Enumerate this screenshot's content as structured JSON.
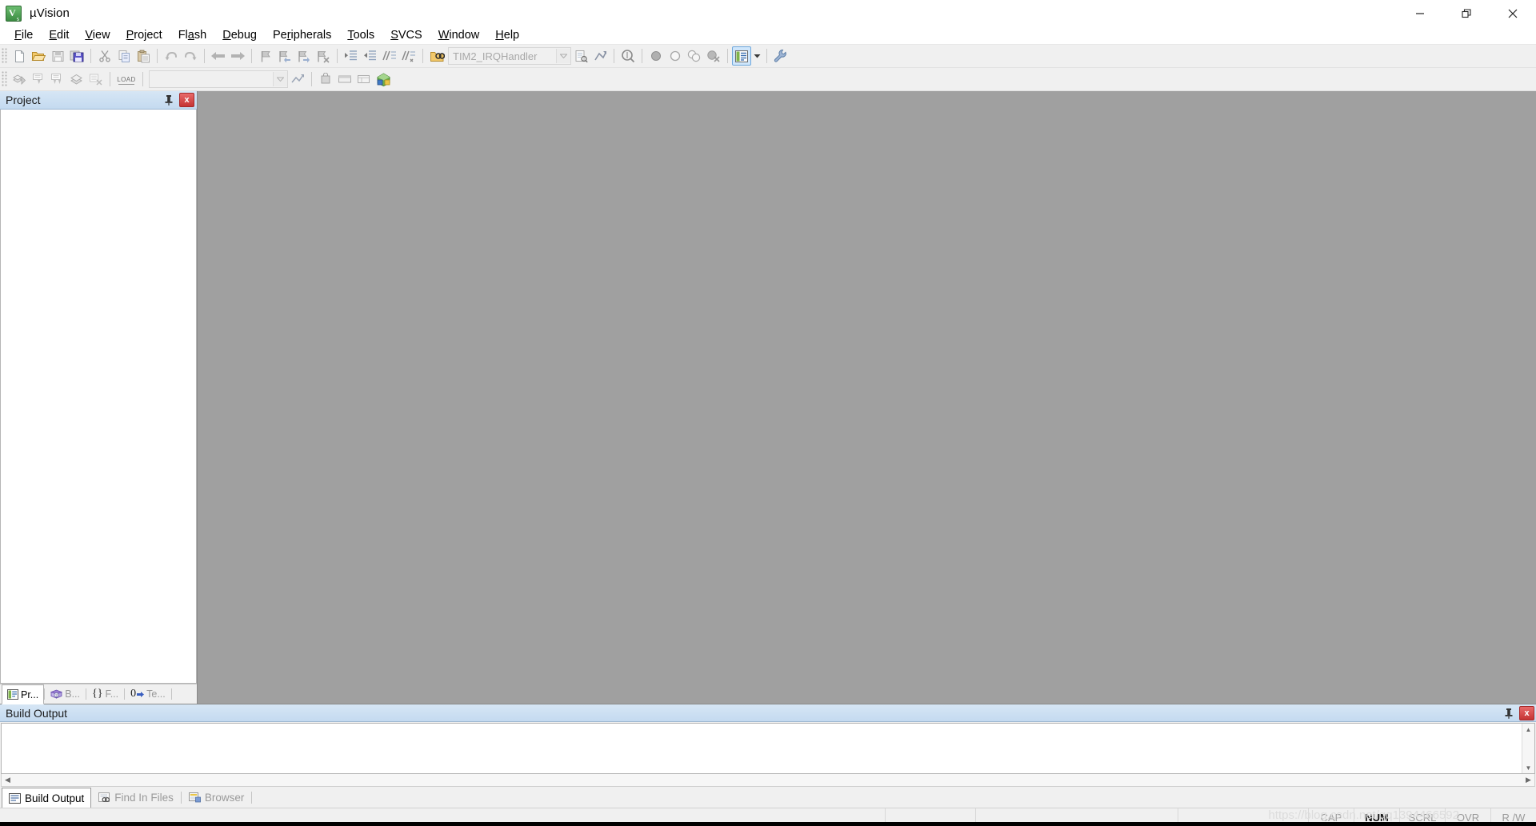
{
  "window": {
    "title": "µVision",
    "app_icon": "uvision-app-icon",
    "controls": {
      "minimize": "Minimize",
      "restore": "Restore",
      "close": "Close"
    }
  },
  "menubar": {
    "items": [
      {
        "label": "File",
        "accel": "F"
      },
      {
        "label": "Edit",
        "accel": "E"
      },
      {
        "label": "View",
        "accel": "V"
      },
      {
        "label": "Project",
        "accel": "P"
      },
      {
        "label": "Flash",
        "accel": "a"
      },
      {
        "label": "Debug",
        "accel": "D"
      },
      {
        "label": "Peripherals",
        "accel": "r"
      },
      {
        "label": "Tools",
        "accel": "T"
      },
      {
        "label": "SVCS",
        "accel": "S"
      },
      {
        "label": "Window",
        "accel": "W"
      },
      {
        "label": "Help",
        "accel": "H"
      }
    ]
  },
  "toolbar_file": {
    "buttons": [
      {
        "name": "new-file-icon",
        "label": "New"
      },
      {
        "name": "open-file-icon",
        "label": "Open"
      },
      {
        "name": "save-icon",
        "label": "Save"
      },
      {
        "name": "save-all-icon",
        "label": "Save All"
      },
      {
        "name": "cut-icon",
        "label": "Cut"
      },
      {
        "name": "copy-icon",
        "label": "Copy"
      },
      {
        "name": "paste-icon",
        "label": "Paste"
      },
      {
        "name": "undo-icon",
        "label": "Undo"
      },
      {
        "name": "redo-icon",
        "label": "Redo"
      },
      {
        "name": "navigate-back-icon",
        "label": "Back"
      },
      {
        "name": "navigate-forward-icon",
        "label": "Forward"
      },
      {
        "name": "bookmark-toggle-icon",
        "label": "Insert/Remove Bookmark"
      },
      {
        "name": "bookmark-prev-icon",
        "label": "Go to Previous Bookmark"
      },
      {
        "name": "bookmark-next-icon",
        "label": "Go to Next Bookmark"
      },
      {
        "name": "bookmark-clear-icon",
        "label": "Clear All Bookmarks"
      },
      {
        "name": "indent-right-icon",
        "label": "Indent Selection"
      },
      {
        "name": "indent-left-icon",
        "label": "Unindent Selection"
      },
      {
        "name": "comment-icon",
        "label": "Comment Selection"
      },
      {
        "name": "uncomment-icon",
        "label": "Uncomment Selection"
      }
    ],
    "function_combo": {
      "name": "function-navigation-combo",
      "value": "TIM2_IRQHandler"
    },
    "after_combo": [
      {
        "name": "find-in-files-icon",
        "label": "Find in Files"
      },
      {
        "name": "incremental-find-icon",
        "label": "Incremental Find"
      },
      {
        "name": "magnifier-icon",
        "label": "Find"
      },
      {
        "name": "breakpoint-insert-icon",
        "label": "Insert/Remove Breakpoint"
      },
      {
        "name": "breakpoint-disable-icon",
        "label": "Enable/Disable Breakpoint"
      },
      {
        "name": "breakpoint-disable-all-icon",
        "label": "Disable All Breakpoints"
      },
      {
        "name": "breakpoint-kill-all-icon",
        "label": "Kill All Breakpoints"
      }
    ],
    "target_options": {
      "name": "configure-target-options-button",
      "label": "Configure Target Options",
      "active": true,
      "highlight_color": "#cfe6fb"
    },
    "wrench": {
      "name": "manage-run-time-environment-icon",
      "label": "Manage Run-Time Environment"
    }
  },
  "toolbar_build": {
    "buttons": [
      {
        "name": "translate-file-icon",
        "label": "Translate Current File"
      },
      {
        "name": "build-target-icon",
        "label": "Build"
      },
      {
        "name": "rebuild-all-icon",
        "label": "Rebuild All Target Files"
      },
      {
        "name": "batch-build-icon",
        "label": "Batch Build"
      },
      {
        "name": "stop-build-icon",
        "label": "Stop Build"
      }
    ],
    "load_button": {
      "name": "download-to-flash-button",
      "label": "LOAD"
    },
    "target_combo": {
      "name": "select-target-combo",
      "value": ""
    },
    "after_combo": [
      {
        "name": "target-options-icon",
        "label": "Options for Target"
      },
      {
        "name": "manage-project-items-icon",
        "label": "Manage Project Items"
      },
      {
        "name": "components-icon",
        "label": "Manage Components"
      },
      {
        "name": "multi-project-icon",
        "label": "Multi-Project"
      },
      {
        "name": "pack-installer-icon",
        "label": "Pack Installer"
      }
    ]
  },
  "project_panel": {
    "title": "Project",
    "pin": {
      "name": "auto-hide-pin-icon",
      "label": "Auto Hide"
    },
    "close": {
      "name": "close-panel-button",
      "label": "x"
    },
    "tree_items": [],
    "tabs": [
      {
        "name": "tab-project",
        "label": "Pr...",
        "icon": "project-icon",
        "active": true
      },
      {
        "name": "tab-books",
        "label": "B...",
        "icon": "books-icon",
        "active": false
      },
      {
        "name": "tab-functions",
        "label": "F...",
        "icon": "functions-icon",
        "glyph": "{}",
        "active": false
      },
      {
        "name": "tab-templates",
        "label": "Te...",
        "icon": "templates-icon",
        "glyph": "0",
        "active": false
      }
    ]
  },
  "editor": {
    "name": "editor-workspace",
    "content": "",
    "background_color": "#a0a0a0"
  },
  "build_output": {
    "title": "Build Output",
    "text": "",
    "pin": {
      "name": "auto-hide-pin-icon",
      "label": "Auto Hide"
    },
    "close": {
      "name": "close-panel-button",
      "label": "x"
    },
    "scroll_up": "▲",
    "scroll_down": "▼",
    "scroll_left": "◀",
    "scroll_right": "▶"
  },
  "bottom_tabs": [
    {
      "name": "tab-build-output",
      "label": "Build Output",
      "icon": "build-output-icon",
      "active": true
    },
    {
      "name": "tab-find-in-files",
      "label": "Find In Files",
      "icon": "find-in-files-icon",
      "active": false
    },
    {
      "name": "tab-browser",
      "label": "Browser",
      "icon": "browser-icon",
      "active": false
    }
  ],
  "statusbar": {
    "message": "",
    "cells": [
      "",
      "",
      ""
    ],
    "indicators": [
      {
        "name": "status-cap",
        "label": "CAP",
        "active": false
      },
      {
        "name": "status-num",
        "label": "NUM",
        "active": true
      },
      {
        "name": "status-scrl",
        "label": "SCRL",
        "active": false
      },
      {
        "name": "status-ovr",
        "label": "OVR",
        "active": false
      },
      {
        "name": "status-rw",
        "label": "R /W",
        "active": false
      }
    ],
    "watermark": "https://blog.csdn.net/qq1394466592"
  }
}
